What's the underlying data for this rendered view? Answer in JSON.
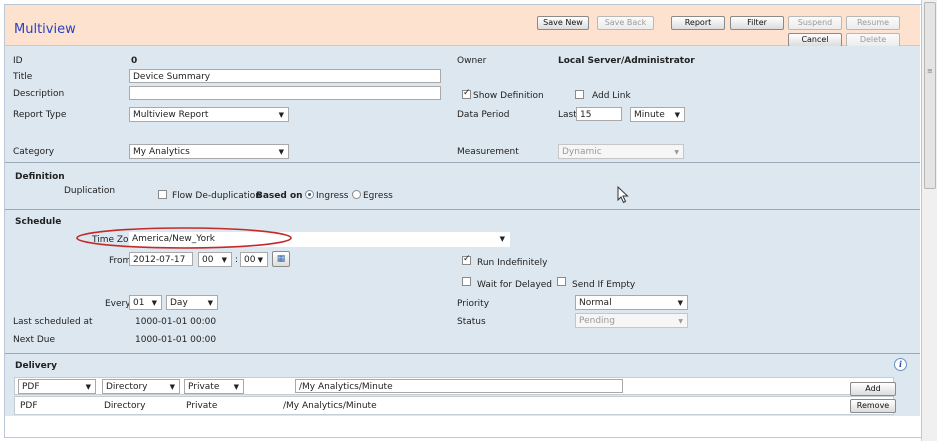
{
  "header": {
    "title": "Multiview",
    "buttons": {
      "save_new": "Save New",
      "save_back": "Save Back",
      "report": "Report",
      "filter": "Filter",
      "suspend": "Suspend",
      "resume": "Resume",
      "cancel": "Cancel",
      "delete": "Delete"
    }
  },
  "general": {
    "id_label": "ID",
    "id_value": "0",
    "title_label": "Title",
    "title_value": "Device Summary",
    "description_label": "Description",
    "description_value": "",
    "report_type_label": "Report Type",
    "report_type_value": "Multiview Report",
    "category_label": "Category",
    "category_value": "My Analytics",
    "owner_label": "Owner",
    "owner_value": "Local Server/Administrator",
    "show_definition_label": "Show Definition",
    "show_definition_checked": true,
    "add_link_label": "Add Link",
    "add_link_checked": false,
    "data_period_label": "Data Period",
    "data_period_last_label": "Last",
    "data_period_value": "15",
    "data_period_unit": "Minute",
    "measurement_label": "Measurement",
    "measurement_value": "Dynamic"
  },
  "definition": {
    "section_label": "Definition",
    "duplication_label": "Duplication",
    "flow_dedup_label": "Flow De-duplication",
    "based_on_label": "Based on",
    "ingress_label": "Ingress",
    "egress_label": "Egress",
    "selected": "Ingress"
  },
  "schedule": {
    "section_label": "Schedule",
    "time_zone_label": "Time Zone",
    "time_zone_value": "America/New_York",
    "from_label": "From",
    "from_date": "2012-07-17",
    "from_hour": "00",
    "time_sep": ":",
    "from_minute": "00",
    "run_indefinitely_label": "Run Indefinitely",
    "run_indefinitely_checked": true,
    "wait_for_delayed_label": "Wait for Delayed",
    "send_if_empty_label": "Send If Empty",
    "every_label": "Every",
    "every_value": "01",
    "every_unit": "Day",
    "priority_label": "Priority",
    "priority_value": "Normal",
    "status_label": "Status",
    "status_value": "Pending",
    "last_scheduled_label": "Last scheduled at",
    "last_scheduled_value": "1000-01-01 00:00",
    "next_due_label": "Next Due",
    "next_due_value": "1000-01-01 00:00"
  },
  "delivery": {
    "section_label": "Delivery",
    "new_row": {
      "format": "PDF",
      "method": "Directory",
      "visibility": "Private",
      "path": "/My Analytics/Minute",
      "add_label": "Add"
    },
    "rows": [
      {
        "format": "PDF",
        "method": "Directory",
        "visibility": "Private",
        "path": "/My Analytics/Minute",
        "remove_label": "Remove"
      }
    ]
  },
  "colors": {
    "header_bg": "#fde3cf",
    "body_bg": "#dde7ef",
    "title_color": "#2a3fbf",
    "highlight_oval": "#c42a2a"
  }
}
